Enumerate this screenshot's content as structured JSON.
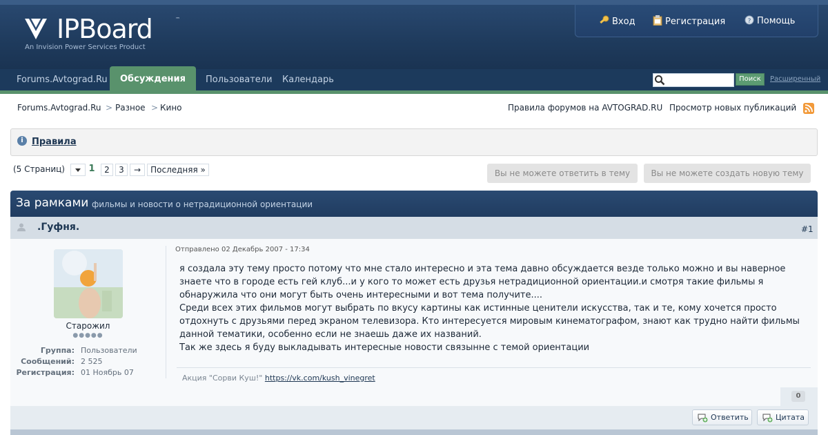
{
  "header": {
    "logo_text": "IPBoard",
    "logo_tm": "™",
    "logo_tagline": "An Invision Power Services Product",
    "user_links": {
      "login": "Вход",
      "register": "Регистрация",
      "help": "Помощь"
    }
  },
  "nav": {
    "tabs": [
      "Forums.Avtograd.Ru",
      "Обсуждения",
      "Пользователи",
      "Календарь"
    ],
    "active_tab": "Обсуждения",
    "search_button": "Поиск",
    "search_placeholder": "",
    "advanced_search": "Расширенный"
  },
  "breadcrumb": {
    "items": [
      "Forums.Avtograd.Ru",
      "Разное",
      "Кино"
    ],
    "separator": ">"
  },
  "top_links": {
    "rules": "Правила форумов на AVTOGRAD.RU",
    "new_posts": "Просмотр новых публикаций"
  },
  "rules_box": {
    "label": "Правила"
  },
  "pagination": {
    "pages_label": "(5 Страниц)",
    "current": "1",
    "pages": [
      "2",
      "3"
    ],
    "next": "→",
    "last": "Последняя »"
  },
  "actions": {
    "cannot_reply": "Вы не можете ответить в тему",
    "cannot_new_topic": "Вы не можете создать новую тему"
  },
  "topic": {
    "title": "За рамками",
    "description": "фильмы и новости о нетрадиционной ориентации"
  },
  "post": {
    "author": ".Гуфня.",
    "number": "#1",
    "rank": "Старожил",
    "rank_pips": "●●●●●",
    "info": {
      "group_label": "Группа:",
      "group_value": "Пользователи",
      "posts_label": "Сообщений:",
      "posts_value": "2 525",
      "joined_label": "Регистрация:",
      "joined_value": "01 Ноябрь 07"
    },
    "date": "Отправлено 02 Декабрь 2007 - 17:34",
    "paragraphs": [
      "я создала эту тему просто потому что мне стало интересно и эта тема давно обсуждается везде только можно и вы наверное знаете что в городе есть гей клуб...и у кого то может есть друзья нетрадиционной ориентации.и смотря такие фильмы я обнаружила что они могут быть очень интересными и вот тема получите....",
      "Среди всех этих фильмов могут выбрать по вкусу картины как истинные ценители искусства, так и те, кому хочется просто отдохнуть с друзьями перед экраном телевизора. Кто интересуется мировым кинематографом, знают как трудно найти фильмы данной тематики, особенно если не знаешь даже их названий.",
      "Так же здесь я буду выкладывать интересные новости связынне с темой ориентации"
    ],
    "signature_text": "Акция \"Сорви Куш!\"",
    "signature_link": "https://vk.com/kush_vinegret",
    "reputation": "0",
    "reply_button": "Ответить",
    "quote_button": "Цитата"
  },
  "colors": {
    "header_blue": "#1f3b5d",
    "accent_green": "#59926c",
    "link_blue": "#1d3652"
  }
}
